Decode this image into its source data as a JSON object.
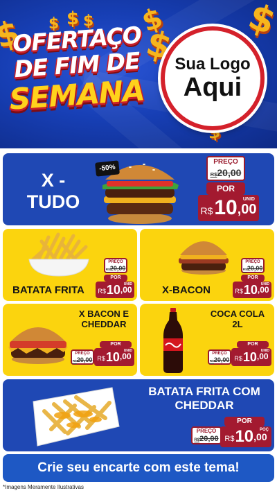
{
  "header": {
    "title_line1": "OFERTAÇO",
    "title_line2": "DE FIM DE",
    "title_line3": "SEMANA",
    "logo_line1": "Sua Logo",
    "logo_line2": "Aqui"
  },
  "labels": {
    "preco": "PREÇO",
    "por": "POR",
    "currency": "R$",
    "unit": "UNID"
  },
  "products": [
    {
      "name": "X - TUDO",
      "old_price": "20,00",
      "price_int": "10",
      "price_cents": ",00",
      "badge": "-50%",
      "image": "burger-icon"
    },
    {
      "name": "BATATA FRITA",
      "old_price": "20,00",
      "price_int": "10",
      "price_cents": ",00",
      "image": "fries-icon"
    },
    {
      "name": "X-BACON",
      "old_price": "20,00",
      "price_int": "10",
      "price_cents": ",00",
      "image": "burger-icon"
    },
    {
      "name": "X BACON E CHEDDAR",
      "old_price": "20,00",
      "price_int": "10",
      "price_cents": ",00",
      "image": "burger-icon"
    },
    {
      "name": "COCA COLA 2L",
      "old_price": "20,00",
      "price_int": "10",
      "price_cents": ",00",
      "image": "soda-bottle-icon"
    },
    {
      "name": "BATATA FRITA COM CHEDDAR",
      "old_price": "20,00",
      "price_int": "10",
      "price_cents": ",00",
      "unit": "POÇ",
      "image": "cheese-fries-icon"
    }
  ],
  "footer": {
    "cta": "Crie seu encarte com este tema!",
    "disclaimer": "*Imagens Meramente Ilustrativas"
  },
  "colors": {
    "header_blue": "#173fb5",
    "card_blue": "#1f48b4",
    "card_yellow": "#fbd40e",
    "price_red": "#a31a30",
    "title_yellow": "#ffd21c"
  }
}
